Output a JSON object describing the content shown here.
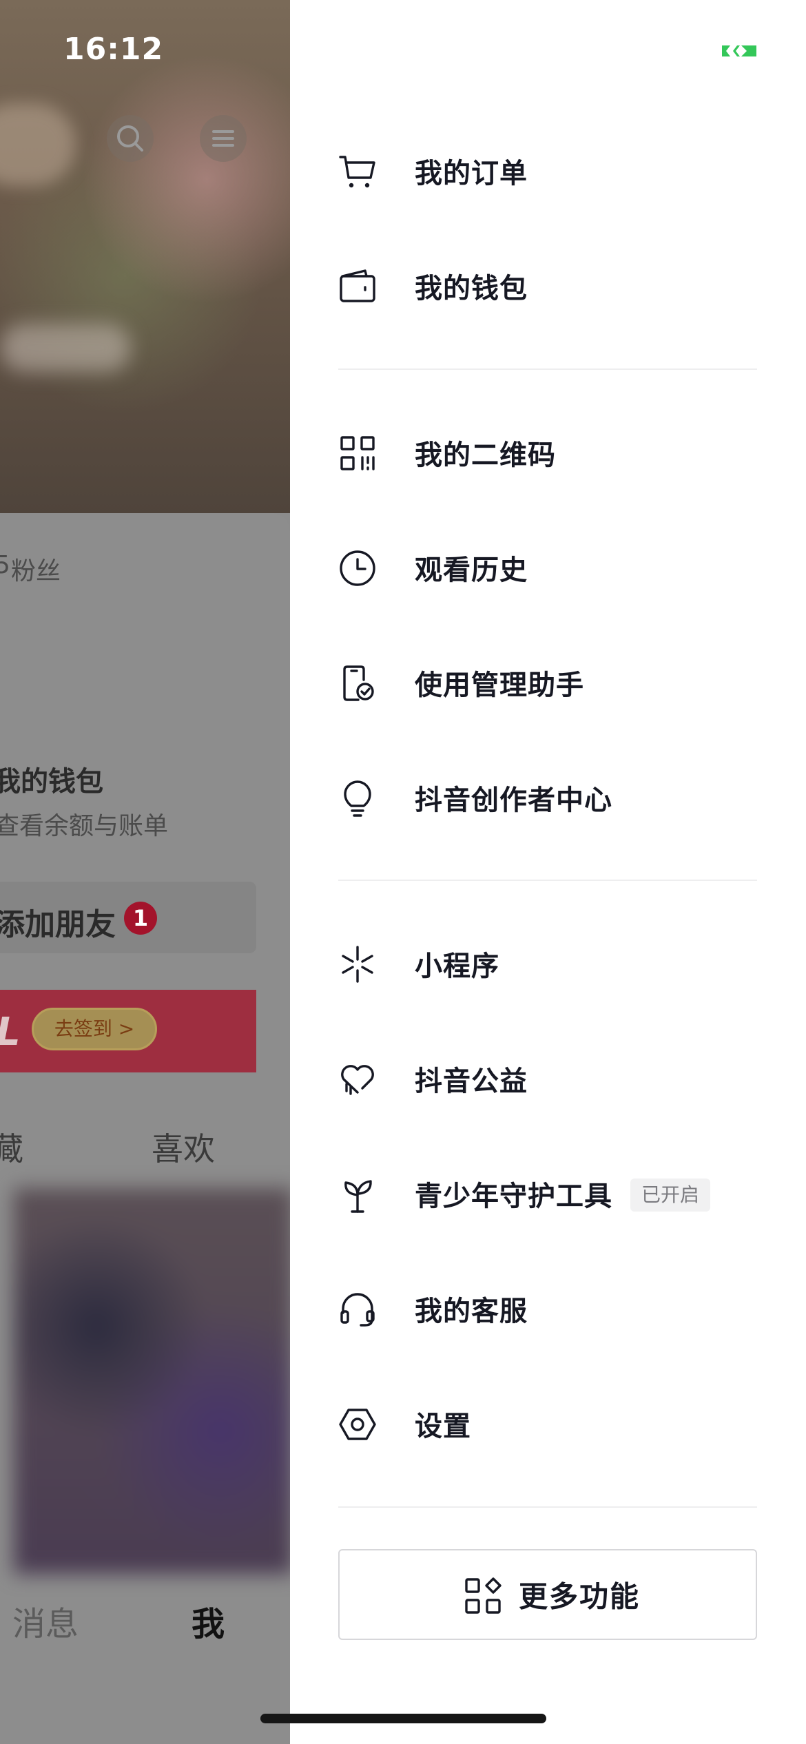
{
  "status_bar": {
    "time": "16:12"
  },
  "background_page": {
    "fans_label": "粉丝",
    "fans_prefix": "5",
    "wallet_title": "我的钱包",
    "wallet_subtitle": "查看余额与账单",
    "add_friends_label": "添加朋友",
    "add_friends_badge": "1",
    "banner_letter": "L",
    "sign_in_label": "去签到 >",
    "tab_favorites": "藏",
    "tab_likes": "喜欢",
    "nav_messages": "消息",
    "nav_me": "我"
  },
  "drawer": {
    "groups": [
      [
        {
          "label": "我的订单",
          "icon": "cart-icon"
        },
        {
          "label": "我的钱包",
          "icon": "wallet-icon"
        }
      ],
      [
        {
          "label": "我的二维码",
          "icon": "qr-code-icon"
        },
        {
          "label": "观看历史",
          "icon": "clock-icon"
        },
        {
          "label": "使用管理助手",
          "icon": "phone-check-icon"
        },
        {
          "label": "抖音创作者中心",
          "icon": "lightbulb-icon"
        }
      ],
      [
        {
          "label": "小程序",
          "icon": "mini-program-icon"
        },
        {
          "label": "抖音公益",
          "icon": "heart-icon"
        },
        {
          "label": "青少年守护工具",
          "icon": "sprout-icon",
          "tag": "已开启"
        },
        {
          "label": "我的客服",
          "icon": "headset-icon"
        },
        {
          "label": "设置",
          "icon": "settings-hexagon-icon"
        }
      ]
    ],
    "more_button_label": "更多功能"
  },
  "colors": {
    "battery_green": "#34c759",
    "badge_red": "#a3132b",
    "text_primary": "#161823"
  }
}
